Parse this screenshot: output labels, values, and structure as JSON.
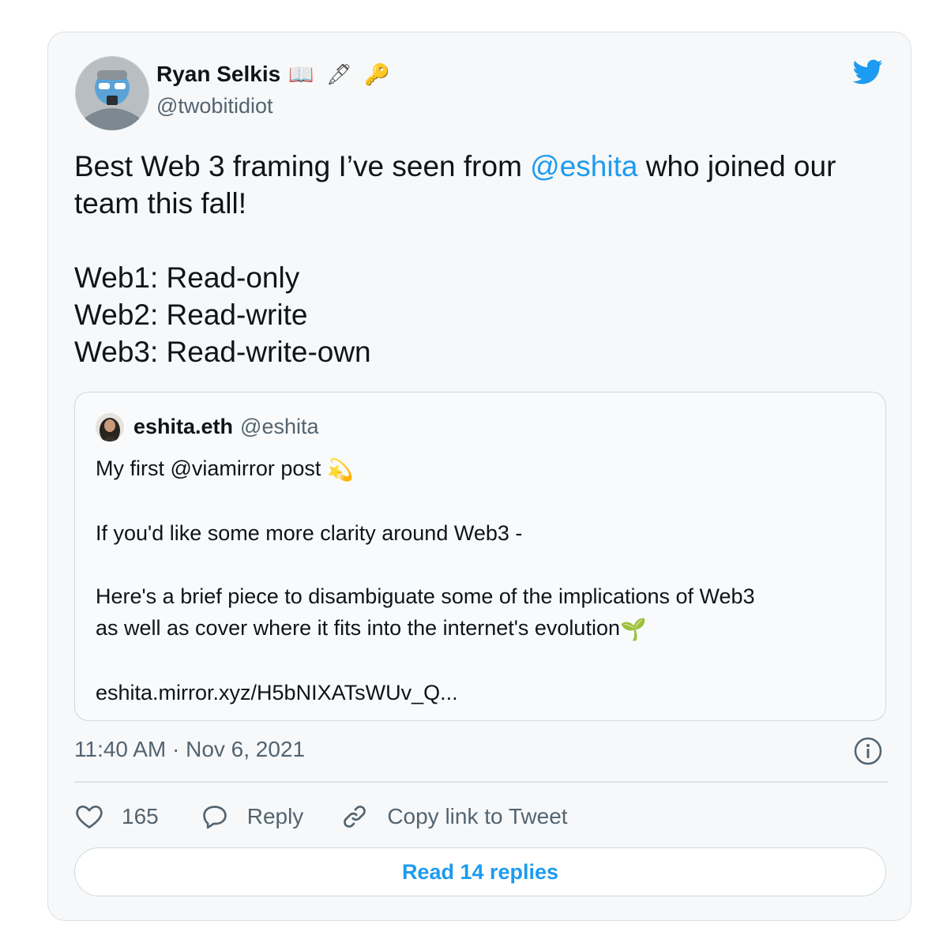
{
  "tweet": {
    "author_name": "Ryan Selkis",
    "author_emojis": "📖 🖋 🔑",
    "author_handle": "@twobitidiot",
    "text_before_mention": "Best Web 3 framing I’ve seen from ",
    "mention": "@eshita",
    "text_after_mention": " who joined our\nteam this fall!\n\nWeb1: Read-only\nWeb2: Read-write\nWeb3: Read-write-own",
    "timestamp": "11:40 AM · Nov 6, 2021"
  },
  "quote": {
    "name": "eshita.eth",
    "handle": "@eshita",
    "line1": "My first @viamirror post ",
    "line1_emoji": "💫",
    "body": "If you'd like some more clarity around Web3 -\n\nHere's a brief piece to disambiguate some of the implications of Web3\nas well as cover where it fits into the internet's evolution",
    "body_emoji": "🌱",
    "link": "eshita.mirror.xyz/H5bNIXATsWUv_Q..."
  },
  "actions": {
    "like_count": "165",
    "reply_label": "Reply",
    "copy_link_label": "Copy link to Tweet"
  },
  "read_replies_label": "Read 14 replies",
  "colors": {
    "accent": "#1d9bf0",
    "text": "#0f1419",
    "secondary": "#536471"
  },
  "icons": [
    "twitter-bird-icon",
    "info-icon",
    "heart-icon",
    "reply-bubble-icon",
    "link-icon"
  ]
}
